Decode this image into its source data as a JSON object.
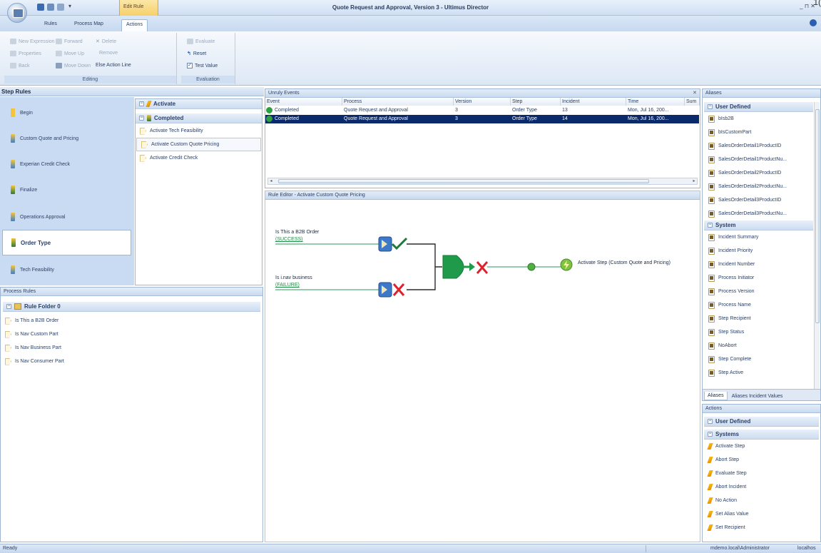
{
  "window": {
    "title": "Quote Request and Approval, Version 3 - Ultimus Director",
    "context_tab_group": "Edit Rule",
    "controls": "_ ⊓ ✕",
    "corner_clip": "1("
  },
  "tabs": [
    "Rules",
    "Process Map",
    "Actions"
  ],
  "ribbon": {
    "editing": {
      "label": "Editing",
      "buttons": [
        "New Expression",
        "Forward",
        "Delete",
        "Properties",
        "Move Up",
        "Remove",
        "Back",
        "Move Down",
        "Else Action Line"
      ]
    },
    "evaluation": {
      "label": "Evaluation",
      "buttons": [
        "Evaluate",
        "Reset",
        "Test Value"
      ]
    }
  },
  "step_rules": {
    "title": "Step Rules",
    "steps": [
      "Begin",
      "Custom Quote and Pricing",
      "Experian Credit Check",
      "Finalize",
      "Operations Approval",
      "Order Type",
      "Tech Feasibility"
    ],
    "events": {
      "activate": "Activate",
      "completed": "Completed",
      "rules": [
        "Activate Tech Feasibility",
        "Activate Custom Quote Pricing",
        "Activate Credit Check"
      ]
    }
  },
  "process_rules": {
    "title": "Process Rules",
    "folder": "Rule Folder 0",
    "items": [
      "Is This a B2B Order",
      "Is Nav Custom Part",
      "Is Nav Business Part",
      "Is Nav Consumer Part"
    ]
  },
  "unruly_events": {
    "title": "Unruly Events",
    "columns": [
      "Event",
      "Process",
      "Version",
      "Step",
      "Incident",
      "Time",
      "Sum"
    ],
    "rows": [
      {
        "event": "Completed",
        "process": "Quote Request and Approval",
        "version": "3",
        "step": "Order Type",
        "incident": "13",
        "time": "Mon, Jul 16, 200..."
      },
      {
        "event": "Completed",
        "process": "Quote Request and Approval",
        "version": "3",
        "step": "Order Type",
        "incident": "14",
        "time": "Mon, Jul 16, 200..."
      }
    ]
  },
  "rule_editor": {
    "title": "Rule Editor - Activate Custom Quote Pricing",
    "cond1_label": "Is This a B2B Order",
    "cond1_result": "(SUCCESS)",
    "cond2_label": "Is i.nav business",
    "cond2_result": "(FAILURE)",
    "action_label": "Activate Step (Custom Quote and Pricing)"
  },
  "aliases": {
    "title": "Aliases",
    "user_defined_label": "User Defined",
    "user_defined": [
      "bIsb2B",
      "bIsCustomPart",
      "SalesOrderDetail1ProductID",
      "SalesOrderDetail1ProductNu...",
      "SalesOrderDetail2ProductID",
      "SalesOrderDetail2ProductNu...",
      "SalesOrderDetail3ProductID",
      "SalesOrderDetail3ProductNu..."
    ],
    "system_label": "System",
    "system": [
      "Incident Summary",
      "Incident Priority",
      "Incident Number",
      "Process Initiator",
      "Process Version",
      "Process Name",
      "Step Recipient",
      "Step Status",
      "NoAbort",
      "Step Complete",
      "Step Active"
    ],
    "tabs": [
      "Aliases",
      "Aliases Incident Values"
    ]
  },
  "actions": {
    "title": "Actions",
    "user_defined_label": "User Defined",
    "systems_label": "Systems",
    "items": [
      "Activate Step",
      "Abort Step",
      "Evaluate Step",
      "Abort Incident",
      "No Action",
      "Set Alias Value",
      "Set Recipient"
    ]
  },
  "status": {
    "left": "Ready",
    "user": "mdemo.local\\Administrator",
    "host": "localhos"
  },
  "colors": {
    "accent": "#2b4168",
    "selection": "#0b2a6b",
    "success": "#2ea040",
    "failure": "#e0202b"
  }
}
